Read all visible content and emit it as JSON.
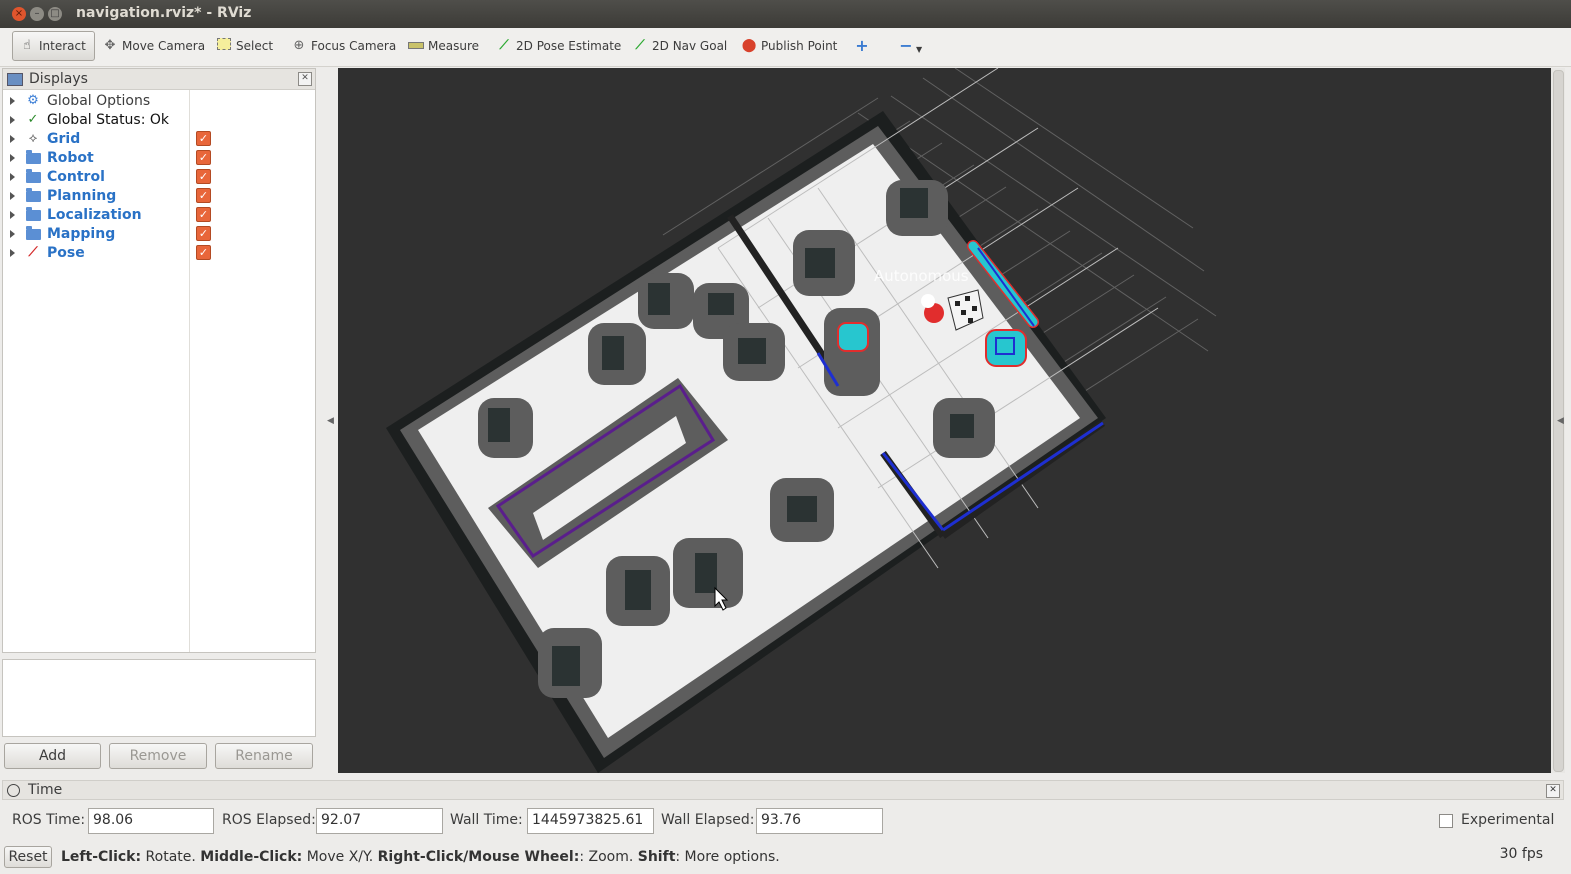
{
  "window": {
    "title": "navigation.rviz* - RViz"
  },
  "toolbar": {
    "interact": "Interact",
    "move_camera": "Move Camera",
    "select": "Select",
    "focus_camera": "Focus Camera",
    "measure": "Measure",
    "pose_estimate": "2D Pose Estimate",
    "nav_goal": "2D Nav Goal",
    "publish_point": "Publish Point"
  },
  "displays": {
    "title": "Displays",
    "items": [
      {
        "label": "Global Options",
        "icon": "gear-icon"
      },
      {
        "label": "Global Status: Ok",
        "icon": "checkmark-icon"
      },
      {
        "label": "Grid",
        "icon": "grid-icon",
        "checked": true
      },
      {
        "label": "Robot",
        "icon": "folder-icon",
        "checked": true
      },
      {
        "label": "Control",
        "icon": "folder-icon",
        "checked": true
      },
      {
        "label": "Planning",
        "icon": "folder-icon",
        "checked": true
      },
      {
        "label": "Localization",
        "icon": "folder-icon",
        "checked": true
      },
      {
        "label": "Mapping",
        "icon": "folder-icon",
        "checked": true
      },
      {
        "label": "Pose",
        "icon": "arrow-icon",
        "checked": true
      }
    ],
    "buttons": {
      "add": "Add",
      "remove": "Remove",
      "rename": "Rename"
    }
  },
  "viewport": {
    "robot_label": "Autonomous"
  },
  "time": {
    "title": "Time",
    "ros_time_label": "ROS Time:",
    "ros_time": "98.06",
    "ros_elapsed_label": "ROS Elapsed:",
    "ros_elapsed": "92.07",
    "wall_time_label": "Wall Time:",
    "wall_time": "1445973825.61",
    "wall_elapsed_label": "Wall Elapsed:",
    "wall_elapsed": "93.76",
    "experimental": "Experimental"
  },
  "status": {
    "reset": "Reset",
    "left_click": "Left-Click:",
    "left_click_action": " Rotate. ",
    "middle_click": "Middle-Click:",
    "middle_click_action": " Move X/Y. ",
    "right_click": "Right-Click/Mouse Wheel:",
    "right_click_action": ": Zoom. ",
    "shift": "Shift",
    "shift_action": ": More options.",
    "fps": "30 fps"
  },
  "colors": {
    "accent": "#e8663a",
    "tree_blue": "#2a72c6",
    "viewport_bg": "#303030"
  }
}
